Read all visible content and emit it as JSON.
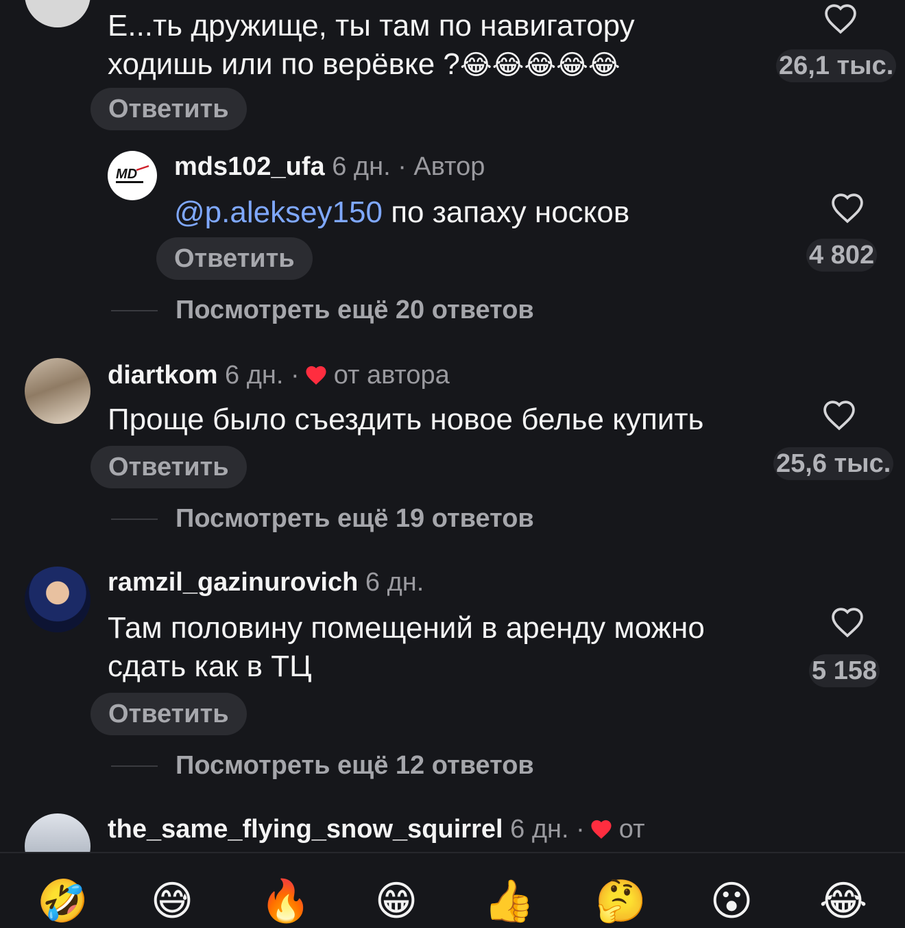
{
  "comments": [
    {
      "text_line1": "Е...ть дружище, ты там по навигатору",
      "text_line2": "ходишь или по верёвке ?",
      "emoji_tail": "😂😂😂😂😂",
      "likes": "26,1 тыс.",
      "reply_label": "Ответить"
    },
    {
      "username": "mds102_ufa",
      "time": "6 дн.",
      "badge": "· Автор",
      "mention": "@p.aleksey150",
      "text": "по запаху носков",
      "likes": "4 802",
      "reply_label": "Ответить",
      "more_replies": "Посмотреть ещё 20 ответов",
      "avatar_logo": "MD"
    },
    {
      "username": "diartkom",
      "time": "6 дн.",
      "separator": "·",
      "badge": "от автора",
      "text": "Проще было съездить новое белье купить",
      "likes": "25,6 тыс.",
      "reply_label": "Ответить",
      "more_replies": "Посмотреть ещё 19 ответов"
    },
    {
      "username": "ramzil_gazinurovich",
      "time": "6 дн.",
      "text_line1": "Там половину помещений в аренду можно",
      "text_line2": "сдать как в ТЦ",
      "likes": "5 158",
      "reply_label": "Ответить",
      "more_replies": "Посмотреть ещё 12 ответов"
    },
    {
      "username": "the_same_flying_snow_squirrel",
      "time": "6 дн.",
      "separator": "·",
      "badge": "от"
    }
  ],
  "emoji_bar": [
    "🤣",
    "😅",
    "🔥",
    "😁",
    "👍",
    "🤔",
    "😮",
    "😂"
  ],
  "colors": {
    "background": "#16171b",
    "mention": "#7fa8ff",
    "author_heart": "#ff2d3f",
    "pill": "#2b2c31"
  }
}
